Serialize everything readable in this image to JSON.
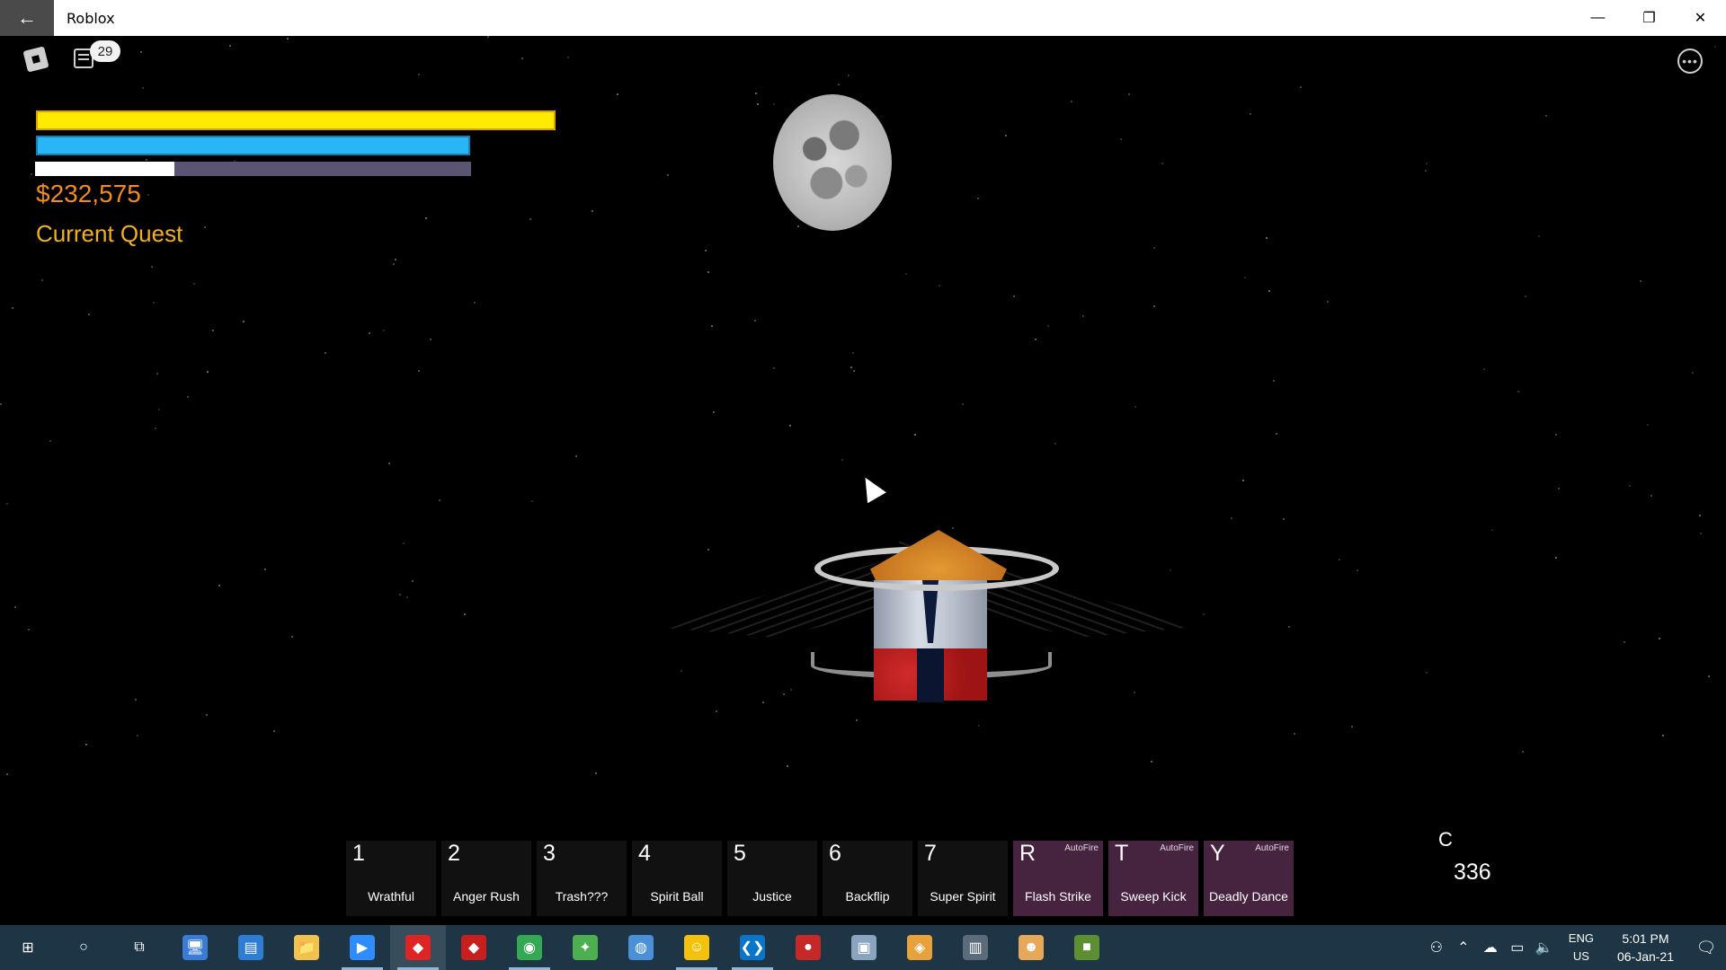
{
  "window": {
    "title": "Roblox"
  },
  "topbar": {
    "chat_badge": "29"
  },
  "hud": {
    "health_fill": 1.0,
    "ki_fill": 1.0,
    "xp_fill": 0.32,
    "money": "$232,575",
    "quest_title": "Current Quest",
    "colors": {
      "health": "#ffea00",
      "ki": "#29b6f6",
      "xp": "#ffffff",
      "money": "#f28c1b",
      "quest": "#f0b020"
    }
  },
  "hotbar": [
    {
      "key": "1",
      "label": "Wrathful",
      "autofire": ""
    },
    {
      "key": "2",
      "label": "Anger Rush",
      "autofire": ""
    },
    {
      "key": "3",
      "label": "Trash???",
      "autofire": ""
    },
    {
      "key": "4",
      "label": "Spirit Ball",
      "autofire": ""
    },
    {
      "key": "5",
      "label": "Justice",
      "autofire": ""
    },
    {
      "key": "6",
      "label": "Backflip",
      "autofire": ""
    },
    {
      "key": "7",
      "label": "Super Spirit",
      "autofire": ""
    },
    {
      "key": "R",
      "label": "Flash Strike",
      "autofire": "AutoFire"
    },
    {
      "key": "T",
      "label": "Sweep Kick",
      "autofire": "AutoFire"
    },
    {
      "key": "Y",
      "label": "Deadly Dance",
      "autofire": "AutoFire"
    }
  ],
  "counter": {
    "key": "C",
    "value": "336"
  },
  "taskbar": {
    "apps": [
      {
        "name": "start-icon",
        "glyph": "⊞",
        "color": "transparent"
      },
      {
        "name": "search-circle-icon",
        "glyph": "○",
        "color": "transparent"
      },
      {
        "name": "task-view-icon",
        "glyph": "⧉",
        "color": "transparent"
      },
      {
        "name": "desktop-app-icon",
        "glyph": "🖥",
        "color": "#3a7bd5"
      },
      {
        "name": "contacts-app-icon",
        "glyph": "▤",
        "color": "#2d7dd2"
      },
      {
        "name": "file-explorer-icon",
        "glyph": "📁",
        "color": "#f2c14e"
      },
      {
        "name": "zoom-icon",
        "glyph": "▶",
        "color": "#2d8cff"
      },
      {
        "name": "roblox-app-icon",
        "glyph": "◆",
        "color": "#e02424"
      },
      {
        "name": "roblox-studio-icon",
        "glyph": "◆",
        "color": "#c81e1e"
      },
      {
        "name": "chrome-icon",
        "glyph": "◉",
        "color": "#34a853"
      },
      {
        "name": "hummingbird-app-icon",
        "glyph": "✦",
        "color": "#4caf50"
      },
      {
        "name": "globe-app-icon",
        "glyph": "◍",
        "color": "#4a90d9"
      },
      {
        "name": "emoji-app-icon",
        "glyph": "☺",
        "color": "#f4c20d"
      },
      {
        "name": "vscode-icon",
        "glyph": "❮❯",
        "color": "#0a74c9"
      },
      {
        "name": "among-us-icon",
        "glyph": "●",
        "color": "#c62828"
      },
      {
        "name": "disk-utility-icon",
        "glyph": "▣",
        "color": "#8aa4c0"
      },
      {
        "name": "diamond-app-icon",
        "glyph": "◈",
        "color": "#e9a23b"
      },
      {
        "name": "terminal-app-icon",
        "glyph": "▥",
        "color": "#5c6b7a"
      },
      {
        "name": "anime-game-icon",
        "glyph": "☻",
        "color": "#e6a95a"
      },
      {
        "name": "minecraft-icon",
        "glyph": "■",
        "color": "#5b8f32"
      }
    ],
    "language": "ENG",
    "region": "US",
    "time": "5:01 PM",
    "date": "06-Jan-21"
  }
}
